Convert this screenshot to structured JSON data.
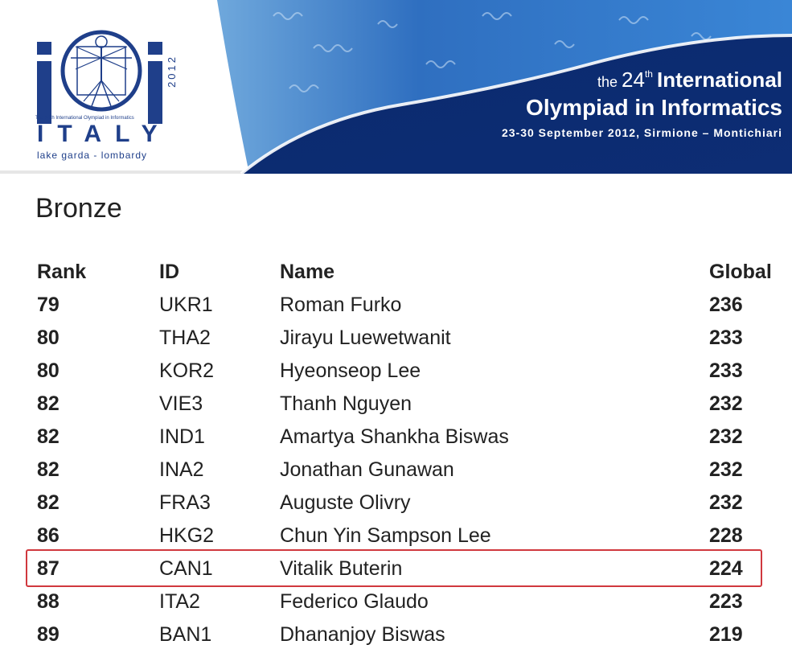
{
  "banner": {
    "logo": {
      "small_text": "The 24th International Olympiad in Informatics",
      "year": "2012",
      "country": "ITALY",
      "subtitle": "lake garda - lombardy"
    },
    "pre_prefix": "the",
    "pre_number": "24",
    "pre_suffix": "th",
    "pre_rest": "International",
    "title": "Olympiad in Informatics",
    "date": "23-30 September 2012, Sirmione – Montichiari",
    "colors": {
      "brand_blue": "#1f3f8a",
      "banner_dark": "#0d2d74",
      "banner_light": "#3a86d6"
    }
  },
  "section": {
    "heading": "Bronze"
  },
  "table": {
    "columns": {
      "rank": "Rank",
      "id": "ID",
      "name": "Name",
      "global": "Global"
    },
    "rows": [
      {
        "rank": "79",
        "id": "UKR1",
        "name": "Roman Furko",
        "global": "236"
      },
      {
        "rank": "80",
        "id": "THA2",
        "name": "Jirayu Luewetwanit",
        "global": "233"
      },
      {
        "rank": "80",
        "id": "KOR2",
        "name": "Hyeonseop Lee",
        "global": "233"
      },
      {
        "rank": "82",
        "id": "VIE3",
        "name": "Thanh Nguyen",
        "global": "232"
      },
      {
        "rank": "82",
        "id": "IND1",
        "name": "Amartya Shankha Biswas",
        "global": "232"
      },
      {
        "rank": "82",
        "id": "INA2",
        "name": "Jonathan Gunawan",
        "global": "232"
      },
      {
        "rank": "82",
        "id": "FRA3",
        "name": "Auguste Olivry",
        "global": "232"
      },
      {
        "rank": "86",
        "id": "HKG2",
        "name": "Chun Yin Sampson Lee",
        "global": "228"
      },
      {
        "rank": "87",
        "id": "CAN1",
        "name": "Vitalik Buterin",
        "global": "224"
      },
      {
        "rank": "88",
        "id": "ITA2",
        "name": "Federico Glaudo",
        "global": "223"
      },
      {
        "rank": "89",
        "id": "BAN1",
        "name": "Dhananjoy Biswas",
        "global": "219"
      }
    ],
    "highlight_color": "#d0383e"
  }
}
